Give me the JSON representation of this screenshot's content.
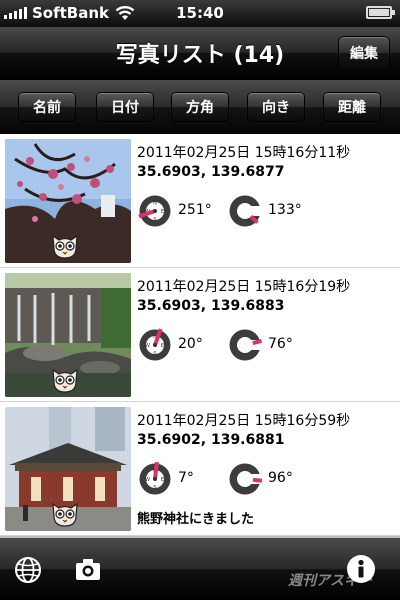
{
  "status_bar": {
    "carrier": "SoftBank",
    "time": "15:40"
  },
  "nav": {
    "title": "写真リスト (14)",
    "edit_label": "編集"
  },
  "sort_buttons": [
    {
      "label": "名前"
    },
    {
      "label": "日付"
    },
    {
      "label": "方角"
    },
    {
      "label": "向き"
    },
    {
      "label": "距離"
    }
  ],
  "photos": [
    {
      "datetime": "2011年02月25日 15時16分11秒",
      "coords": "35.6903, 139.6877",
      "heading": "251°",
      "heading_deg": 251,
      "orientation": "133°",
      "orientation_deg": 133,
      "comment": ""
    },
    {
      "datetime": "2011年02月25日 15時16分19秒",
      "coords": "35.6903, 139.6883",
      "heading": "20°",
      "heading_deg": 20,
      "orientation": "76°",
      "orientation_deg": 76,
      "comment": ""
    },
    {
      "datetime": "2011年02月25日 15時16分59秒",
      "coords": "35.6902, 139.6881",
      "heading": "7°",
      "heading_deg": 7,
      "orientation": "96°",
      "orientation_deg": 96,
      "comment": "熊野神社にきました"
    }
  ],
  "watermark": "週刊アスキー",
  "colors": {
    "accent": "#e0306a",
    "dial": "#3c3c3c"
  }
}
